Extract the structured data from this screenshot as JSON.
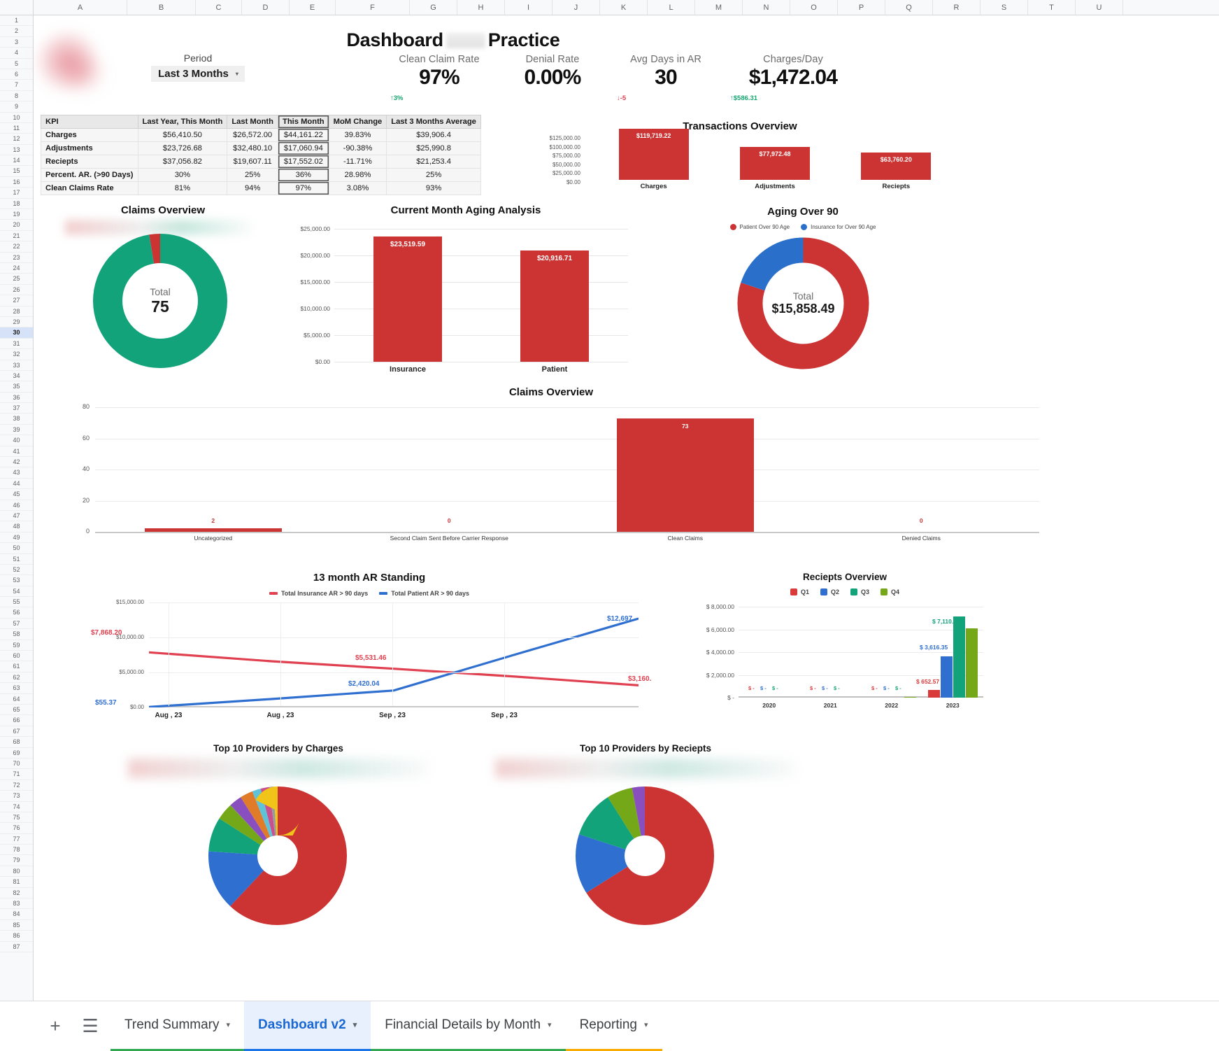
{
  "app": {
    "title": "Dashboard",
    "title_suffix": "Practice"
  },
  "period": {
    "label": "Period",
    "value": "Last 3 Months",
    "caret": "▾"
  },
  "kpis": [
    {
      "name": "Clean Claim Rate",
      "value": "97%",
      "delta": "↑3%",
      "dir": "up"
    },
    {
      "name": "Denial Rate",
      "value": "0.00%",
      "delta": "",
      "dir": ""
    },
    {
      "name": "Avg Days in AR",
      "value": "30",
      "delta": "↓-5",
      "dir": "down"
    },
    {
      "name": "Charges/Day",
      "value": "$1,472.04",
      "delta": "↑$586.31",
      "dir": "up"
    }
  ],
  "kpi_table": {
    "headers": [
      "KPI",
      "Last Year, This Month",
      "Last Month",
      "This Month",
      "MoM Change",
      "Last 3 Months Average"
    ],
    "rows": [
      {
        "label": "Charges",
        "cells": [
          "$56,410.50",
          "$26,572.00",
          "$44,161.22",
          "39.83%",
          "$39,906.4"
        ]
      },
      {
        "label": "Adjustments",
        "cells": [
          "$23,726.68",
          "$32,480.10",
          "$17,060.94",
          "-90.38%",
          "$25,990.8"
        ]
      },
      {
        "label": "Reciepts",
        "cells": [
          "$37,056.82",
          "$19,607.11",
          "$17,552.02",
          "-11.71%",
          "$21,253.4"
        ]
      },
      {
        "label": "Percent. AR. (>90 Days)",
        "cells": [
          "30%",
          "25%",
          "36%",
          "28.98%",
          "25%"
        ]
      },
      {
        "label": "Clean Claims Rate",
        "cells": [
          "81%",
          "94%",
          "97%",
          "3.08%",
          "93%"
        ]
      }
    ]
  },
  "chart_data": [
    {
      "id": "transactions_overview",
      "type": "bar",
      "title": "Transactions Overview",
      "categories": [
        "Charges",
        "Adjustments",
        "Reciepts"
      ],
      "values": [
        119719.22,
        77972.48,
        63760.2
      ],
      "value_labels": [
        "$119,719.22",
        "$77,972.48",
        "$63,760.20"
      ],
      "yticks": [
        "$125,000.00",
        "$100,000.00",
        "$75,000.00",
        "$50,000.00",
        "$25,000.00",
        "$0.00"
      ],
      "ylim": [
        0,
        125000
      ],
      "color": "#cc3333"
    },
    {
      "id": "claims_overview_donut",
      "type": "pie",
      "title": "Claims Overview",
      "center_label": "Total",
      "center_value": "75",
      "slices": [
        {
          "name": "Clean Claims",
          "value": 73,
          "color": "#12a37a"
        },
        {
          "name": "Uncategorized",
          "value": 2,
          "color": "#cc3333"
        }
      ]
    },
    {
      "id": "current_month_aging_analysis",
      "type": "bar",
      "title": "Current Month Aging Analysis",
      "categories": [
        "Insurance",
        "Patient"
      ],
      "values": [
        23519.59,
        20916.71
      ],
      "value_labels": [
        "$23,519.59",
        "$20,916.71"
      ],
      "yticks": [
        "$25,000.00",
        "$20,000.00",
        "$15,000.00",
        "$10,000.00",
        "$5,000.00",
        "$0.00"
      ],
      "ylim": [
        0,
        25000
      ],
      "color": "#cc3333"
    },
    {
      "id": "aging_over_90",
      "type": "pie",
      "title": "Aging Over 90",
      "center_label": "Total",
      "center_value": "$15,858.49",
      "legend": [
        "Patient Over 90 Age",
        "Insurance for Over 90 Age"
      ],
      "slices": [
        {
          "name": "Patient Over 90 Age",
          "value": 12697,
          "color": "#cc3333"
        },
        {
          "name": "Insurance for Over 90 Age",
          "value": 3160,
          "color": "#2a6fc9"
        }
      ]
    },
    {
      "id": "claims_overview_bar",
      "type": "bar",
      "title": "Claims Overview",
      "categories": [
        "Uncategorized",
        "Second Claim Sent Before Carrier Response",
        "Clean Claims",
        "Denied Claims"
      ],
      "values": [
        2,
        0,
        73,
        0
      ],
      "value_labels": [
        "2",
        "0",
        "73",
        "0"
      ],
      "yticks": [
        "80",
        "60",
        "40",
        "20",
        "0"
      ],
      "ylim": [
        0,
        80
      ],
      "color": "#cc3333"
    },
    {
      "id": "ar_standing_13_month",
      "type": "line",
      "title": "13 month AR Standing",
      "legend": [
        "Total Insurance AR > 90 days",
        "Total Patient AR > 90 days"
      ],
      "xticks": [
        "Aug , 23",
        "Aug , 23",
        "Sep , 23",
        "Sep , 23"
      ],
      "yticks": [
        "$15,000.00",
        "$10,000.00",
        "$5,000.00",
        "$0.00"
      ],
      "ylim": [
        0,
        15000
      ],
      "series": [
        {
          "name": "Total Insurance AR > 90 days",
          "color": "#e0404f",
          "values": [
            7868.2,
            6600,
            5531.46,
            4400,
            3160.0
          ],
          "point_labels": [
            "$7,868.20",
            "",
            "$5,531.46",
            "",
            "$3,160."
          ]
        },
        {
          "name": "Total Patient AR > 90 days",
          "color": "#2f6fd0",
          "values": [
            55.37,
            1200,
            2420.04,
            7600,
            12697
          ],
          "point_labels": [
            "$55.37",
            "",
            "$2,420.04",
            "",
            "$12,697"
          ]
        }
      ]
    },
    {
      "id": "receipts_overview",
      "type": "bar",
      "title": "Reciepts Overview",
      "categories": [
        "2020",
        "2021",
        "2022",
        "2023"
      ],
      "legend": [
        "Q1",
        "Q2",
        "Q3",
        "Q4"
      ],
      "yticks": [
        "$ 8,000.00",
        "$ 6,000.00",
        "$ 4,000.00",
        "$ 2,000.00",
        "$ -"
      ],
      "ylim": [
        0,
        8000
      ],
      "series": [
        {
          "name": "Q1",
          "color": "#d93b3b",
          "values": [
            0,
            0,
            0,
            652.57
          ],
          "labels": [
            "$ -",
            "$ -",
            "$ -",
            "$ 652.57"
          ]
        },
        {
          "name": "Q2",
          "color": "#2f6fd0",
          "values": [
            0,
            0,
            0,
            3616.35
          ],
          "labels": [
            "$ -",
            "$ -",
            "$ -",
            "$ 3,616.35"
          ]
        },
        {
          "name": "Q3",
          "color": "#12a37a",
          "values": [
            0,
            0,
            0,
            7110.58
          ],
          "labels": [
            "$ -",
            "$ -",
            "$ -",
            "$ 7,110.58"
          ]
        },
        {
          "name": "Q4",
          "color": "#74a818",
          "values": [
            0,
            0,
            60,
            6120
          ],
          "labels": [
            "",
            "",
            "",
            ""
          ]
        }
      ]
    },
    {
      "id": "top_10_providers_by_charges",
      "type": "pie",
      "title": "Top 10 Providers by Charges",
      "slices": [
        {
          "value": 62,
          "color": "#cc3333"
        },
        {
          "value": 14,
          "color": "#2f6fd0"
        },
        {
          "value": 8,
          "color": "#12a37a"
        },
        {
          "value": 4,
          "color": "#74a818"
        },
        {
          "value": 3,
          "color": "#8a4fbf"
        },
        {
          "value": 3,
          "color": "#e07b2a"
        },
        {
          "value": 2,
          "color": "#5ec2d8"
        },
        {
          "value": 2,
          "color": "#c94f8e"
        },
        {
          "value": 1,
          "color": "#999999"
        },
        {
          "value": 1,
          "color": "#f0c419"
        }
      ]
    },
    {
      "id": "top_10_providers_by_receipts",
      "type": "pie",
      "title": "Top 10 Providers by Reciepts",
      "slices": [
        {
          "value": 66,
          "color": "#cc3333"
        },
        {
          "value": 14,
          "color": "#2f6fd0"
        },
        {
          "value": 11,
          "color": "#12a37a"
        },
        {
          "value": 6,
          "color": "#74a818"
        },
        {
          "value": 3,
          "color": "#8a4fbf"
        }
      ]
    }
  ],
  "sheet": {
    "columns": [
      "A",
      "B",
      "C",
      "D",
      "E",
      "F",
      "G",
      "H",
      "I",
      "J",
      "K",
      "L",
      "M",
      "N",
      "O",
      "P",
      "Q",
      "R",
      "S",
      "T",
      "U"
    ],
    "selected_row": 30
  },
  "tabbar": {
    "add_label": "+",
    "list_label": "☰",
    "tabs": [
      {
        "label": "Trend Summary",
        "caret": "▾",
        "active": false,
        "color": "c-green"
      },
      {
        "label": "Dashboard v2",
        "caret": "▾",
        "active": true,
        "color": "c-blue"
      },
      {
        "label": "Financial Details by Month",
        "caret": "▾",
        "active": false,
        "color": "c-green2"
      },
      {
        "label": "Reporting",
        "caret": "▾",
        "active": false,
        "color": "c-orange"
      }
    ]
  }
}
